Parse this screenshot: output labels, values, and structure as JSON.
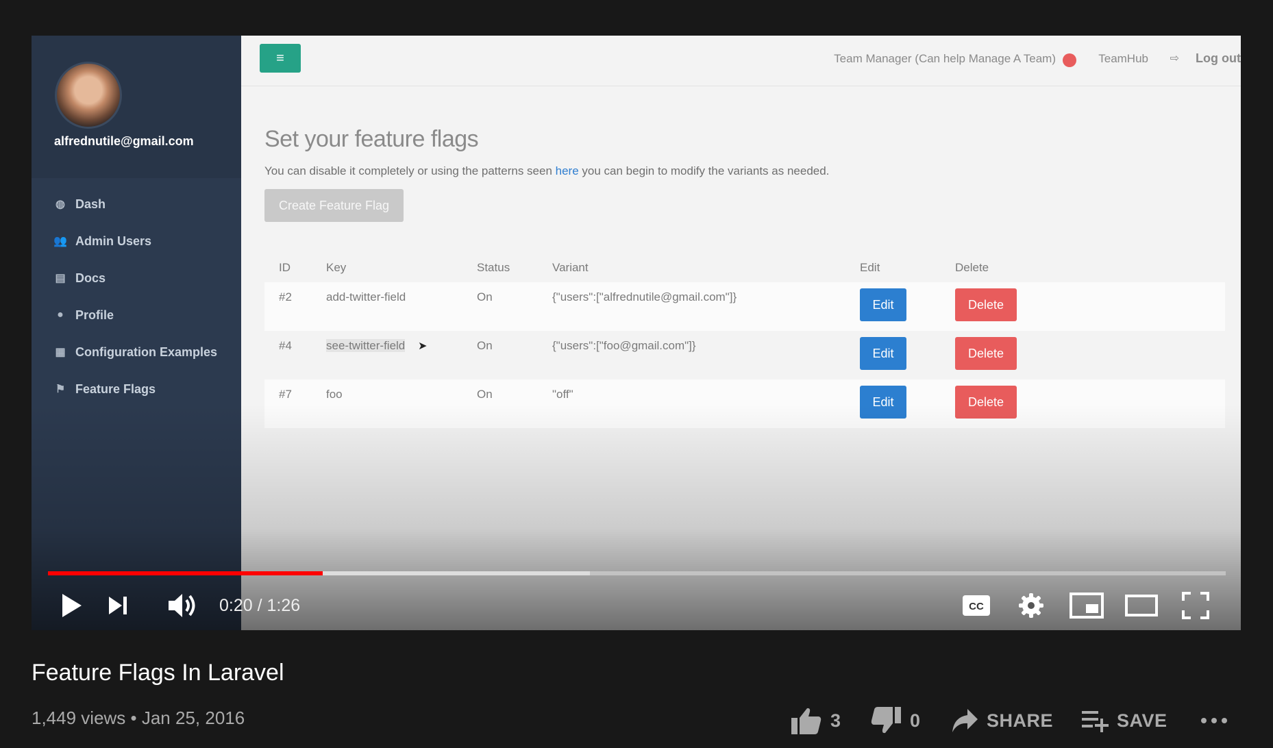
{
  "sidebar": {
    "email": "alfrednutile@gmail.com",
    "items": [
      {
        "icon": "dashboard-icon",
        "glyph": "◍",
        "label": "Dash"
      },
      {
        "icon": "users-icon",
        "glyph": "👥",
        "label": "Admin Users"
      },
      {
        "icon": "document-icon",
        "glyph": "▤",
        "label": "Docs"
      },
      {
        "icon": "user-icon",
        "glyph": "●",
        "label": "Profile"
      },
      {
        "icon": "grid-icon",
        "glyph": "▦",
        "label": "Configuration Examples"
      },
      {
        "icon": "flag-icon",
        "glyph": "⚑",
        "label": "Feature Flags"
      }
    ]
  },
  "topbar": {
    "role": "Team Manager (Can help Manage A Team)",
    "hub": "TeamHub",
    "logout": "Log out"
  },
  "page": {
    "title": "Set your feature flags",
    "desc_before": "You can disable it completely or using the patterns seen ",
    "desc_link": "here",
    "desc_after": " you can begin to modify the variants as needed.",
    "create_button": "Create Feature Flag"
  },
  "table": {
    "headers": [
      "ID",
      "Key",
      "Status",
      "Variant",
      "Edit",
      "Delete"
    ],
    "rows": [
      {
        "id": "#2",
        "key": "add-twitter-field",
        "status": "On",
        "variant": "{\"users\":[\"alfrednutile@gmail.com\"]}",
        "edit": "Edit",
        "delete": "Delete"
      },
      {
        "id": "#4",
        "key": "see-twitter-field",
        "status": "On",
        "variant": "{\"users\":[\"foo@gmail.com\"]}",
        "edit": "Edit",
        "delete": "Delete"
      },
      {
        "id": "#7",
        "key": "foo",
        "status": "On",
        "variant": "\"off\"",
        "edit": "Edit",
        "delete": "Delete"
      }
    ]
  },
  "player": {
    "time_current": "0:20",
    "time_total": "1:26",
    "time_display": "0:20 / 1:26",
    "played_fraction": 0.233,
    "loaded_fraction": 0.46,
    "accent": "#ff0000"
  },
  "video": {
    "title": "Feature Flags In Laravel",
    "meta": "1,449 views • Jan 25, 2016",
    "likes": "3",
    "dislikes": "0",
    "share_label": "SHARE",
    "save_label": "SAVE"
  }
}
